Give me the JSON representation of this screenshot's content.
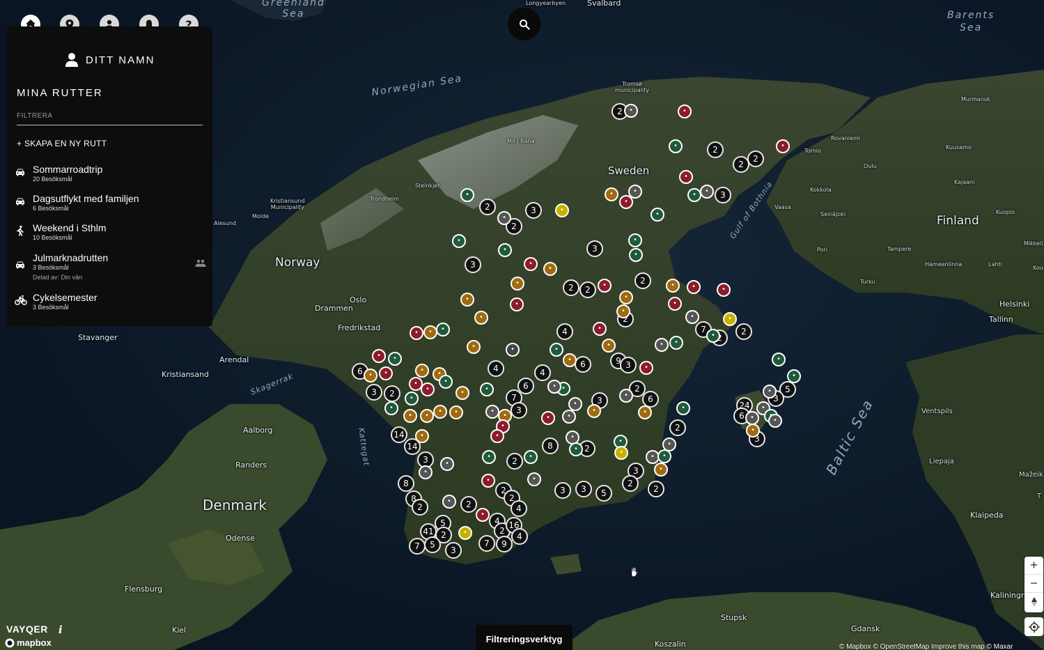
{
  "nav": {
    "icons": [
      "home-icon",
      "map-pin-icon",
      "user-icon",
      "bell-icon",
      "help-icon"
    ],
    "help_label": "?"
  },
  "user": {
    "name": "DITT NAMN"
  },
  "routes_panel": {
    "title": "MINA RUTTER",
    "filter_placeholder": "FILTRERA",
    "new_route_label": "+ SKAPA EN NY RUTT",
    "routes": [
      {
        "name": "Sommarroadtrip",
        "count": "20 Besöksmål",
        "icon": "car-icon"
      },
      {
        "name": "Dagsutflykt med familjen",
        "count": "6 Besöksmål",
        "icon": "car-icon"
      },
      {
        "name": "Weekend i Sthlm",
        "count": "10 Besöksmål",
        "icon": "walk-icon"
      },
      {
        "name": "Julmarknadrutten",
        "count": "3 Besöksmål",
        "shared": "Delad av: Din vän",
        "icon": "car-icon"
      },
      {
        "name": "Cykelsemester",
        "count": "3 Besöksmål",
        "icon": "bike-icon"
      }
    ]
  },
  "filter_tool_label": "Filtreringsverktyg",
  "brand": "VAYQER",
  "mapbox_label": "mapbox",
  "attribution": "© Mapbox © OpenStreetMap Improve this map © Maxar",
  "zoom": {
    "in": "+",
    "out": "−"
  },
  "map_labels": {
    "seas": [
      "Greenland Sea",
      "Norwegian Sea",
      "Barents Sea",
      "Baltic Sea",
      "Gulf of Bothnia",
      "Skagerrak",
      "Kattegat"
    ],
    "countries": [
      "Norway",
      "Sweden",
      "Finland",
      "Denmark"
    ],
    "cities": [
      "Svalbard",
      "Longyearbyen",
      "Tromsø municipality",
      "Murmansk",
      "Rovaniemi",
      "Tornio",
      "Kuusamo",
      "Oulu",
      "Kajaani",
      "Kokkola",
      "Vaasa",
      "Seinäjoki",
      "Kuopio",
      "Pori",
      "Tampere",
      "Hameenlinna",
      "Lahti",
      "Turku",
      "Helsinki",
      "Tallinn",
      "Mikkeli",
      "Kou",
      "Mo i Rana",
      "Steinkjer",
      "Trondheim",
      "Kristiansund Municipality",
      "Molde",
      "Alesund",
      "Oslo",
      "Drammen",
      "Fredrikstad",
      "Stavanger",
      "Arendal",
      "Kristiansand",
      "Aalborg",
      "Randers",
      "Odense",
      "Flensburg",
      "Kiel",
      "Stupsk",
      "Koszalin",
      "Gdansk",
      "Kaliningrad",
      "Klaipeda",
      "Liepaja",
      "Ventspils",
      "Mažeik",
      "T"
    ]
  }
}
